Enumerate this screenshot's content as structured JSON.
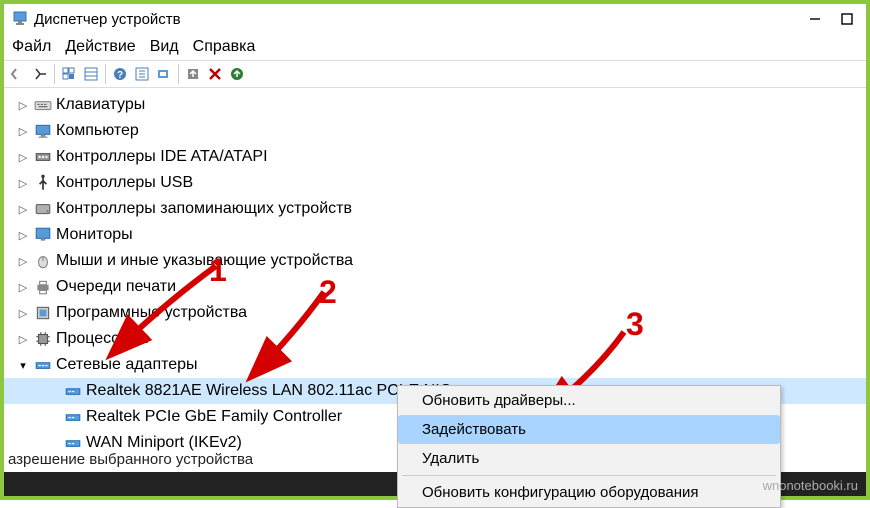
{
  "window": {
    "title": "Диспетчер устройств"
  },
  "menu": {
    "file": "Файл",
    "action": "Действие",
    "view": "Вид",
    "help": "Справка"
  },
  "tree": {
    "keyboards": "Клавиатуры",
    "computer": "Компьютер",
    "ide": "Контроллеры IDE ATA/ATAPI",
    "usb": "Контроллеры USB",
    "storage": "Контроллеры запоминающих устройств",
    "monitors": "Мониторы",
    "mice": "Мыши и иные указывающие устройства",
    "printqueues": "Очереди печати",
    "software": "Программные устройства",
    "processors": "Процессоры",
    "netadapters": "Сетевые адаптеры",
    "realtek_wifi": "Realtek 8821AE Wireless LAN 802.11ac PCI-E NIC",
    "realtek_gbe": "Realtek PCIe GbE Family Controller",
    "wanminiport": "WAN Miniport (IKEv2)"
  },
  "context": {
    "update": "Обновить драйверы...",
    "enable": "Задействовать",
    "delete": "Удалить",
    "refresh": "Обновить конфигурацию оборудования"
  },
  "status": "азрешение выбранного устройства",
  "watermark": "wnonotebooki.ru",
  "annotations": {
    "n1": "1",
    "n2": "2",
    "n3": "3"
  }
}
